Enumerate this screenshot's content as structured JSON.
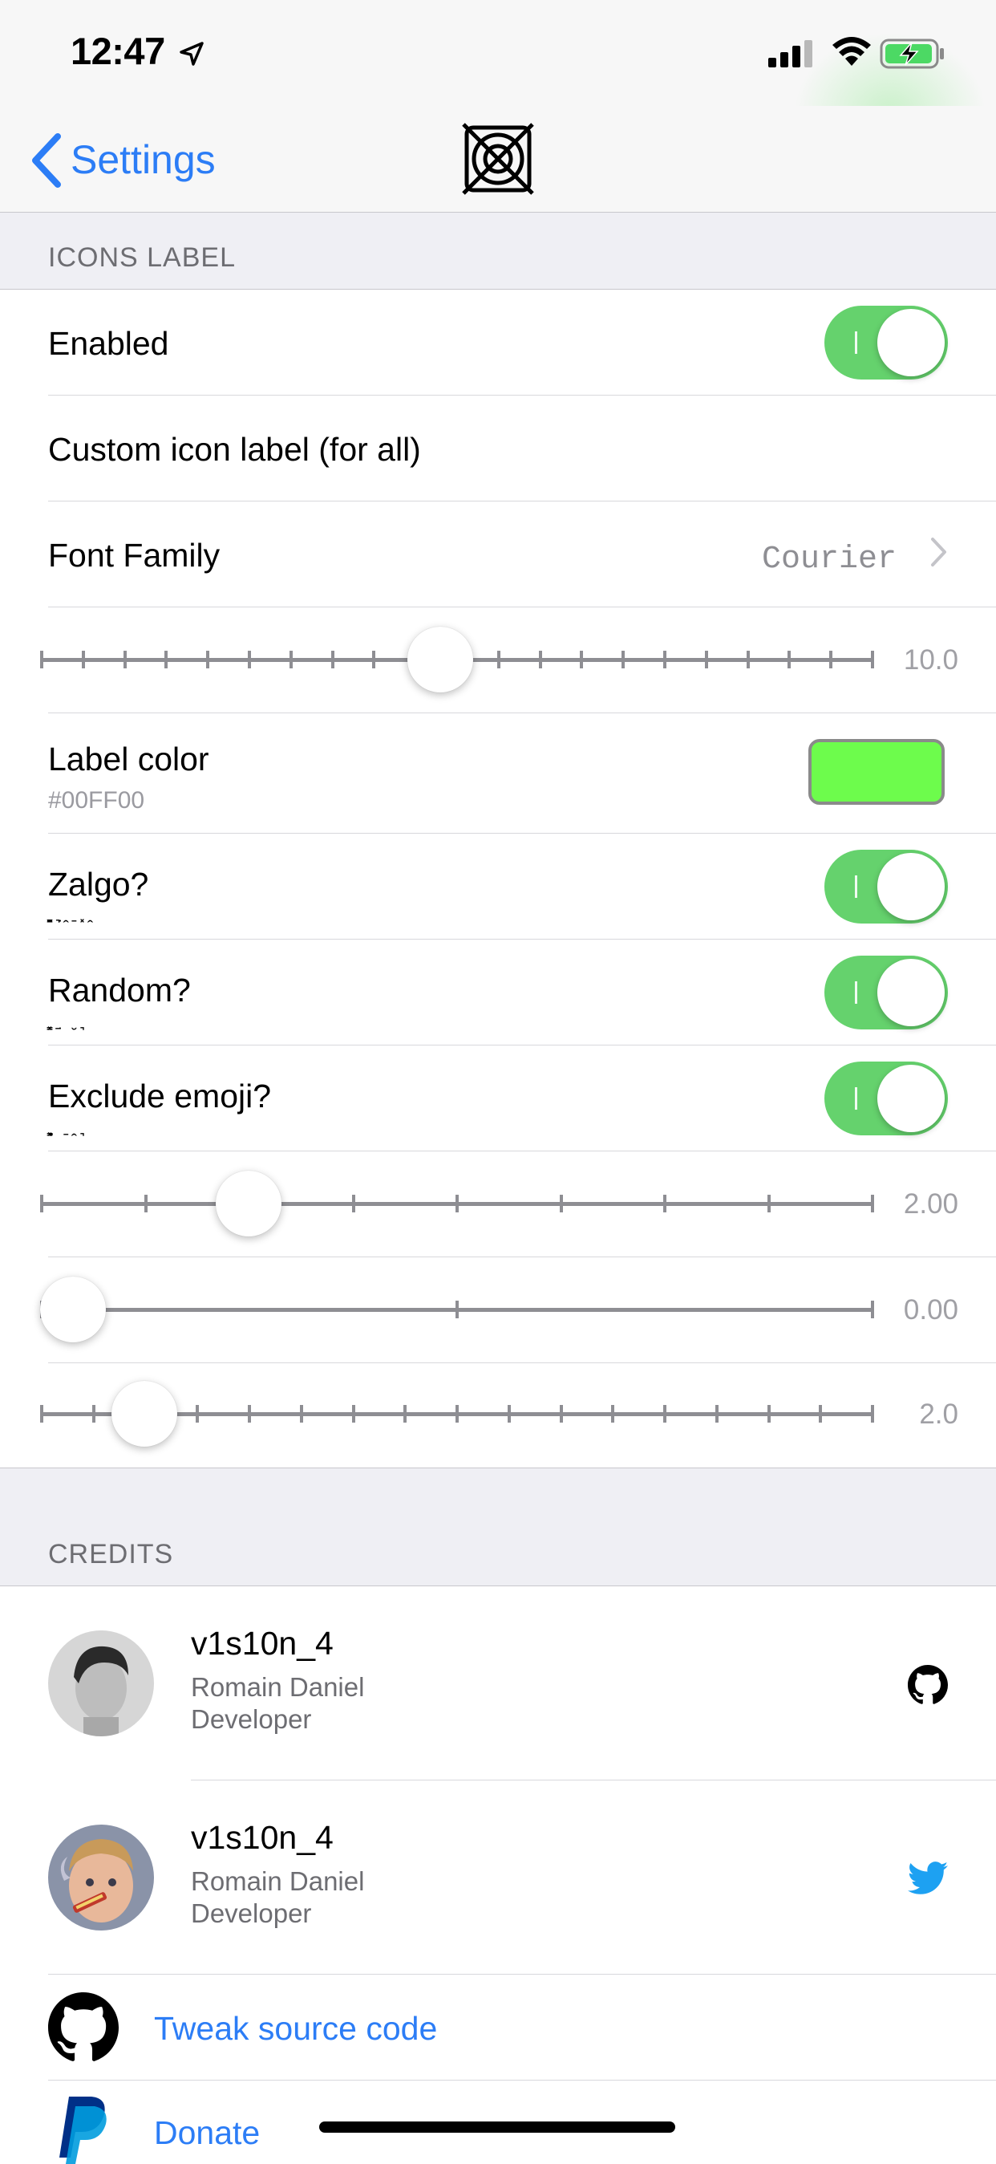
{
  "status_bar": {
    "time": "12:47",
    "icons": [
      "location-arrow-icon",
      "cellular-signal-icon",
      "wifi-icon",
      "battery-charging-icon"
    ]
  },
  "nav": {
    "back_label": "Settings",
    "logo": "tweak-logo-icon"
  },
  "sections": {
    "icons_label": {
      "header": "ICONS LABEL",
      "enabled_label": "Enabled",
      "enabled_on": true,
      "custom_label": "Custom icon label (for all)",
      "font_family_label": "Font Family",
      "font_family_value": "Courier",
      "font_size_value": "10.0",
      "font_size_fraction": 0.48,
      "label_color_label": "Label color",
      "label_color_hex": "#00FF00",
      "label_color_swatch": "#6dfc4c",
      "zalgo_label": "Zalgo?",
      "zalgo_on": true,
      "random_label": "Random?",
      "random_on": true,
      "exclude_emoji_label": "Exclude emoji?",
      "exclude_emoji_on": true,
      "slider_a_value": "2.00",
      "slider_a_fraction": 0.25,
      "slider_b_value": "0.00",
      "slider_b_fraction": 0.0,
      "slider_c_value": "2.0",
      "slider_c_fraction": 0.125
    },
    "credits": {
      "header": "CREDITS",
      "people": [
        {
          "handle": "v1s10n_4",
          "name": "Romain Daniel",
          "role": "Developer",
          "icon": "github-icon"
        },
        {
          "handle": "v1s10n_4",
          "name": "Romain Daniel",
          "role": "Developer",
          "icon": "twitter-icon"
        }
      ],
      "source_label": "Tweak source code",
      "donate_label": "Donate"
    }
  },
  "colors": {
    "accent": "#2c7df6",
    "toggle_on": "#65d26d",
    "twitter": "#1da1f2"
  }
}
